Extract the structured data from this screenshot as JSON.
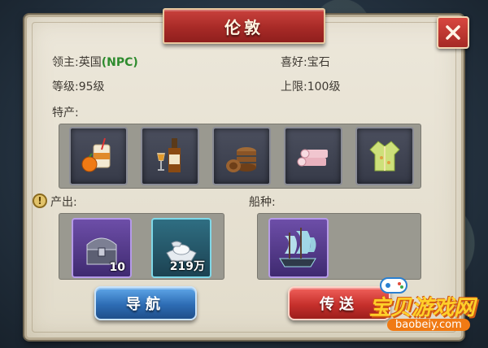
{
  "title": "伦敦",
  "lord_label": "领主:",
  "lord_value": "英国",
  "lord_tag": "(NPC)",
  "preference_label": "喜好:",
  "preference_value": "宝石",
  "level_label": "等级:",
  "level_value": "95级",
  "limit_label": "上限:",
  "limit_value": "100级",
  "specialty_label": "特产:",
  "specialties": [
    {
      "icon": "orange-drink-icon"
    },
    {
      "icon": "wine-bottle-icon"
    },
    {
      "icon": "barrels-icon"
    },
    {
      "icon": "cloth-rolls-icon"
    },
    {
      "icon": "silk-robe-icon"
    }
  ],
  "output_label": "产出:",
  "outputs": [
    {
      "icon": "treasure-chest-icon",
      "qty": "10",
      "rarity_color": "#6d4ea8"
    },
    {
      "icon": "silver-ingot-icon",
      "qty": "219万",
      "rarity_color": "#2f6e82"
    }
  ],
  "ship_label": "船种:",
  "ships": [
    {
      "icon": "sailing-ship-icon",
      "rarity_color": "#6d4ea8"
    }
  ],
  "navigate_button": "导航",
  "teleport_button": "传送",
  "watermark_text": "宝贝游戏网",
  "watermark_url": "baobeiy.com"
}
